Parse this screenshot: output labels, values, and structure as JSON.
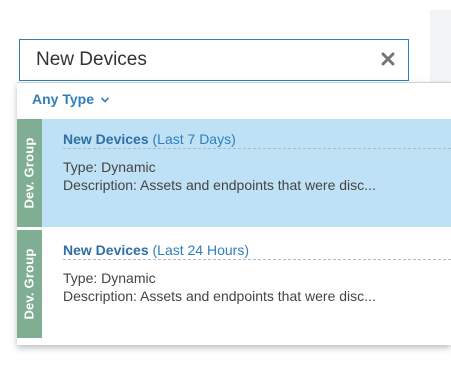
{
  "search": {
    "value": "New Devices",
    "clear_icon": "close-x-icon"
  },
  "filter": {
    "label": "Any Type",
    "icon": "chevron-down-icon"
  },
  "results": [
    {
      "tag": "Dev. Group",
      "name": "New Devices",
      "range": "(Last 7 Days)",
      "type_line": "Type: Dynamic",
      "description_line": "Description: Assets and endpoints that were disc...",
      "selected": true
    },
    {
      "tag": "Dev. Group",
      "name": "New Devices",
      "range": "(Last 24 Hours)",
      "type_line": "Type: Dynamic",
      "description_line": "Description: Assets and endpoints that were disc...",
      "selected": false
    }
  ],
  "colors": {
    "accent": "#2f7fbd",
    "selected_row": "#bfe1f6",
    "tag_bg": "#7fae92"
  }
}
